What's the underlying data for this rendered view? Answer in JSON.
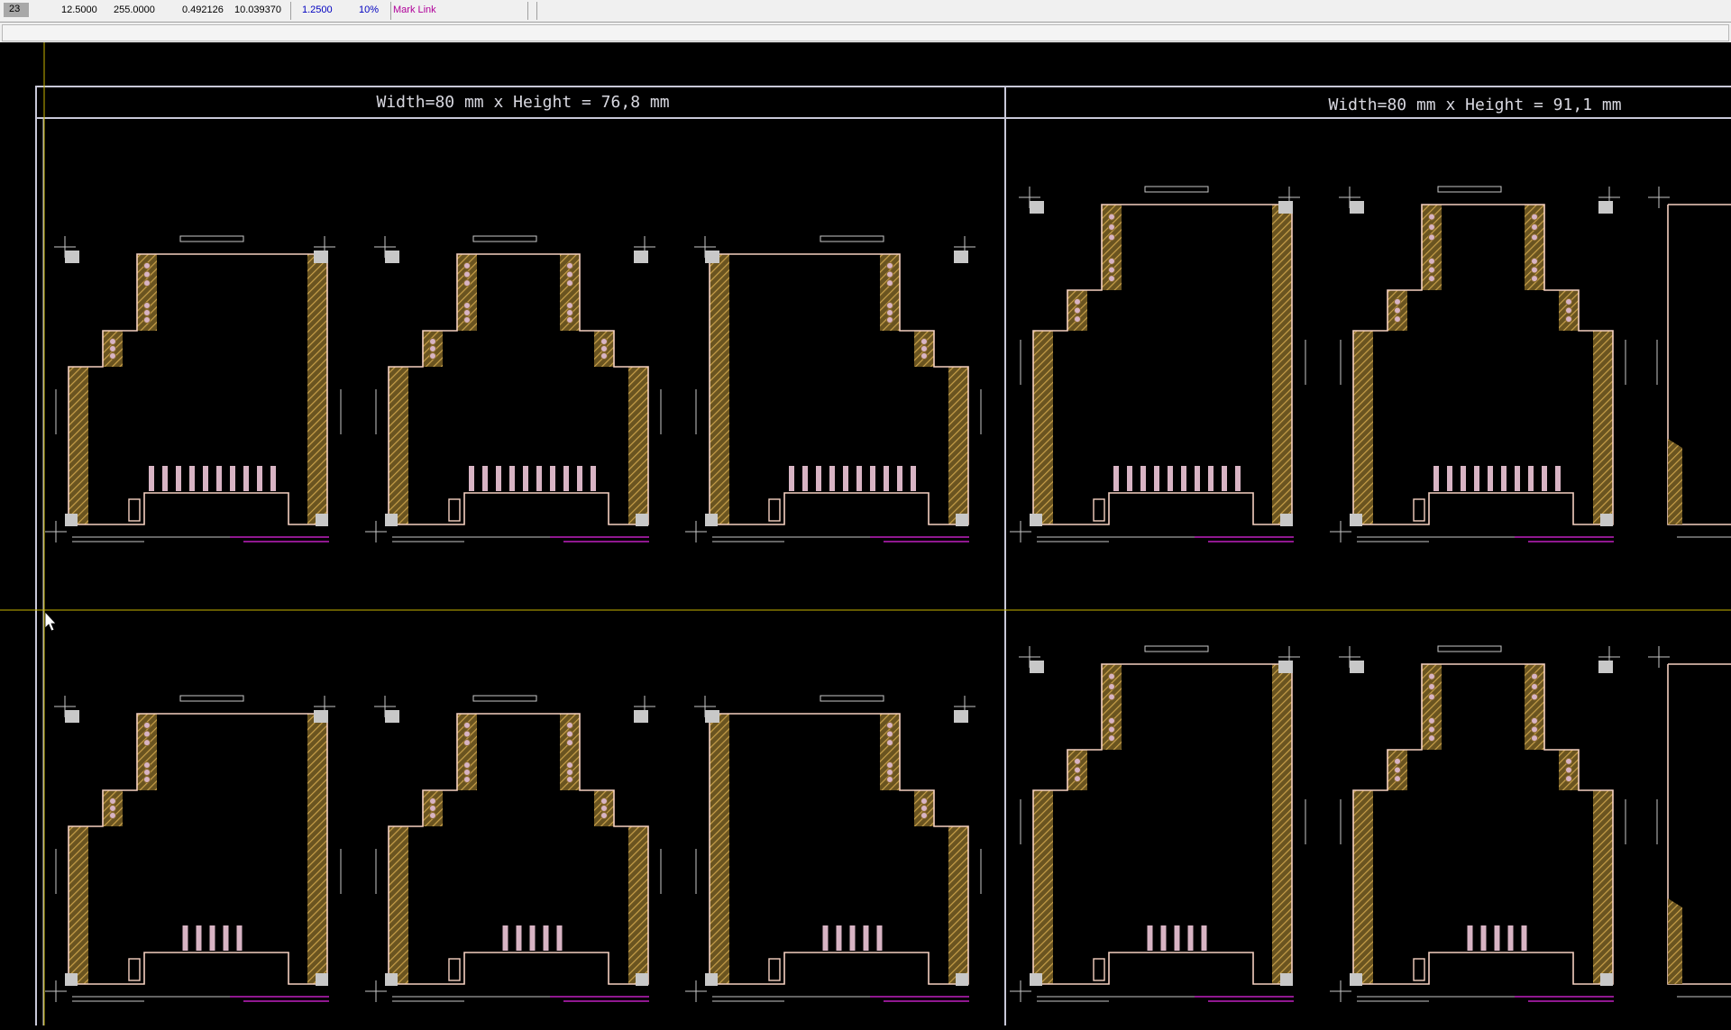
{
  "statusbar": {
    "layer_index": "23",
    "value1": "12.5000",
    "value2": "255.0000",
    "value3": "0.492126",
    "value4": "10.039370",
    "grid": "1.2500",
    "zoom": "10%",
    "mode": "Mark Link"
  },
  "colors": {
    "board_outline": "#f5d0c0",
    "hatch_fill": "#c8a04a",
    "silk": "#c8c8c8",
    "magenta": "#c020c0",
    "pads": "#d8b4c4",
    "cursor_line": "#c8b400",
    "panel_frame": "#c8c8d8"
  },
  "panels": [
    {
      "label": "Width=80 mm x Height = 76,8 mm"
    },
    {
      "label": "Width=80 mm x Height = 91,1 mm"
    }
  ]
}
